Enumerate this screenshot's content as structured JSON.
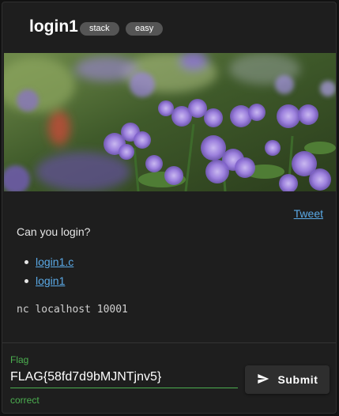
{
  "challenge": {
    "title": "login1",
    "tags": [
      "stack",
      "easy"
    ],
    "tweet_label": "Tweet",
    "description": "Can you login?",
    "files": [
      "login1.c",
      "login1"
    ],
    "connection": "nc localhost 10001"
  },
  "flag_form": {
    "label": "Flag",
    "value": "FLAG{58fd7d9bMJNTjnv5}",
    "helper": "correct",
    "submit_label": "Submit",
    "submit_icon": "send-icon"
  },
  "colors": {
    "link": "#5aa9e6",
    "success": "#4caf50",
    "chip": "#555555",
    "card": "#1e1e1e"
  }
}
